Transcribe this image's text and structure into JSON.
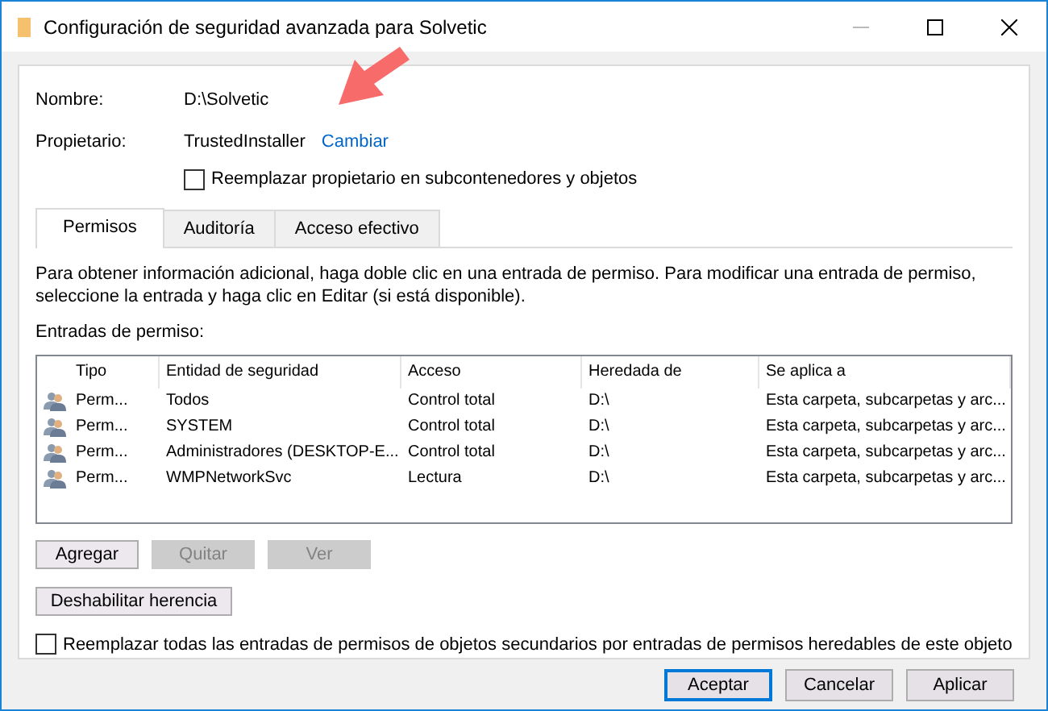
{
  "window": {
    "title": "Configuración de seguridad avanzada para Solvetic"
  },
  "fields": [
    {
      "label": "Nombre:",
      "value": "D:\\Solvetic"
    },
    {
      "label": "Propietario:",
      "value": "TrustedInstaller",
      "link": "Cambiar"
    }
  ],
  "owner_checkbox": {
    "label": "Reemplazar propietario en subcontenedores y objetos",
    "checked": false
  },
  "tabs": [
    {
      "label": "Permisos",
      "selected": true
    },
    {
      "label": "Auditoría",
      "selected": false
    },
    {
      "label": "Acceso efectivo",
      "selected": false
    }
  ],
  "description": "Para obtener información adicional, haga doble clic en una entrada de permiso. Para modificar una entrada de permiso, seleccione la entrada y haga clic en Editar (si está disponible).",
  "entries_label": "Entradas de permiso:",
  "table": {
    "columns": [
      "Tipo",
      "Entidad de seguridad",
      "Acceso",
      "Heredada de",
      "Se aplica a"
    ],
    "rows": [
      [
        "Perm...",
        "Todos",
        "Control total",
        "D:\\",
        "Esta carpeta, subcarpetas y arc..."
      ],
      [
        "Perm...",
        "SYSTEM",
        "Control total",
        "D:\\",
        "Esta carpeta, subcarpetas y arc..."
      ],
      [
        "Perm...",
        "Administradores (DESKTOP-E...",
        "Control total",
        "D:\\",
        "Esta carpeta, subcarpetas y arc..."
      ],
      [
        "Perm...",
        "WMPNetworkSvc",
        "Lectura",
        "D:\\",
        "Esta carpeta, subcarpetas y arc..."
      ]
    ]
  },
  "entry_buttons": [
    {
      "label": "Agregar",
      "disabled": false
    },
    {
      "label": "Quitar",
      "disabled": true
    },
    {
      "label": "Ver",
      "disabled": true
    }
  ],
  "inheritance_button": {
    "label": "Deshabilitar herencia"
  },
  "replace_checkbox": {
    "label": "Reemplazar todas las entradas de permisos de objetos secundarios por entradas de permisos heredables de este objeto",
    "checked": false
  },
  "dialog_buttons": [
    {
      "label": "Aceptar",
      "default": true
    },
    {
      "label": "Cancelar",
      "default": false
    },
    {
      "label": "Aplicar",
      "default": false
    }
  ]
}
